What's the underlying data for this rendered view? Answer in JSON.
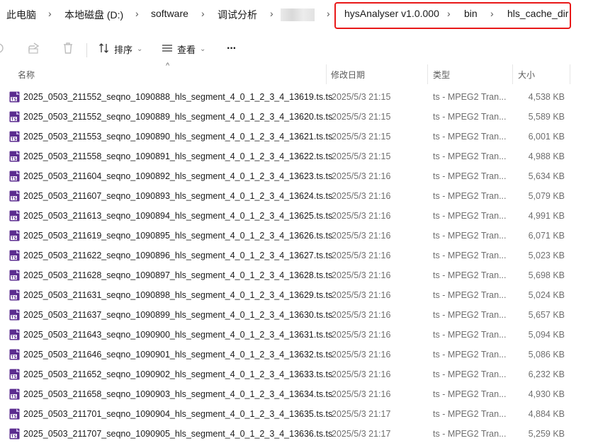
{
  "breadcrumb": {
    "items": [
      "此电脑",
      "本地磁盘 (D:)",
      "software",
      "调试分析",
      "hysAnalyser v1.0.000",
      "bin",
      "hls_cache_dir"
    ],
    "separator": "›"
  },
  "toolbar": {
    "sort_label": "排序",
    "view_label": "查看",
    "more_label": "···"
  },
  "columns": {
    "name": "名称",
    "date": "修改日期",
    "type": "类型",
    "size": "大小"
  },
  "files": [
    {
      "name": "2025_0503_211552_seqno_1090888_hls_segment_4_0_1_2_3_4_13619.ts.ts",
      "date": "2025/5/3 21:15",
      "type": "ts - MPEG2 Tran...",
      "size": "4,538 KB"
    },
    {
      "name": "2025_0503_211552_seqno_1090889_hls_segment_4_0_1_2_3_4_13620.ts.ts",
      "date": "2025/5/3 21:15",
      "type": "ts - MPEG2 Tran...",
      "size": "5,589 KB"
    },
    {
      "name": "2025_0503_211553_seqno_1090890_hls_segment_4_0_1_2_3_4_13621.ts.ts",
      "date": "2025/5/3 21:15",
      "type": "ts - MPEG2 Tran...",
      "size": "6,001 KB"
    },
    {
      "name": "2025_0503_211558_seqno_1090891_hls_segment_4_0_1_2_3_4_13622.ts.ts",
      "date": "2025/5/3 21:15",
      "type": "ts - MPEG2 Tran...",
      "size": "4,988 KB"
    },
    {
      "name": "2025_0503_211604_seqno_1090892_hls_segment_4_0_1_2_3_4_13623.ts.ts",
      "date": "2025/5/3 21:16",
      "type": "ts - MPEG2 Tran...",
      "size": "5,634 KB"
    },
    {
      "name": "2025_0503_211607_seqno_1090893_hls_segment_4_0_1_2_3_4_13624.ts.ts",
      "date": "2025/5/3 21:16",
      "type": "ts - MPEG2 Tran...",
      "size": "5,079 KB"
    },
    {
      "name": "2025_0503_211613_seqno_1090894_hls_segment_4_0_1_2_3_4_13625.ts.ts",
      "date": "2025/5/3 21:16",
      "type": "ts - MPEG2 Tran...",
      "size": "4,991 KB"
    },
    {
      "name": "2025_0503_211619_seqno_1090895_hls_segment_4_0_1_2_3_4_13626.ts.ts",
      "date": "2025/5/3 21:16",
      "type": "ts - MPEG2 Tran...",
      "size": "6,071 KB"
    },
    {
      "name": "2025_0503_211622_seqno_1090896_hls_segment_4_0_1_2_3_4_13627.ts.ts",
      "date": "2025/5/3 21:16",
      "type": "ts - MPEG2 Tran...",
      "size": "5,023 KB"
    },
    {
      "name": "2025_0503_211628_seqno_1090897_hls_segment_4_0_1_2_3_4_13628.ts.ts",
      "date": "2025/5/3 21:16",
      "type": "ts - MPEG2 Tran...",
      "size": "5,698 KB"
    },
    {
      "name": "2025_0503_211631_seqno_1090898_hls_segment_4_0_1_2_3_4_13629.ts.ts",
      "date": "2025/5/3 21:16",
      "type": "ts - MPEG2 Tran...",
      "size": "5,024 KB"
    },
    {
      "name": "2025_0503_211637_seqno_1090899_hls_segment_4_0_1_2_3_4_13630.ts.ts",
      "date": "2025/5/3 21:16",
      "type": "ts - MPEG2 Tran...",
      "size": "5,657 KB"
    },
    {
      "name": "2025_0503_211643_seqno_1090900_hls_segment_4_0_1_2_3_4_13631.ts.ts",
      "date": "2025/5/3 21:16",
      "type": "ts - MPEG2 Tran...",
      "size": "5,094 KB"
    },
    {
      "name": "2025_0503_211646_seqno_1090901_hls_segment_4_0_1_2_3_4_13632.ts.ts",
      "date": "2025/5/3 21:16",
      "type": "ts - MPEG2 Tran...",
      "size": "5,086 KB"
    },
    {
      "name": "2025_0503_211652_seqno_1090902_hls_segment_4_0_1_2_3_4_13633.ts.ts",
      "date": "2025/5/3 21:16",
      "type": "ts - MPEG2 Tran...",
      "size": "6,232 KB"
    },
    {
      "name": "2025_0503_211658_seqno_1090903_hls_segment_4_0_1_2_3_4_13634.ts.ts",
      "date": "2025/5/3 21:16",
      "type": "ts - MPEG2 Tran...",
      "size": "4,930 KB"
    },
    {
      "name": "2025_0503_211701_seqno_1090904_hls_segment_4_0_1_2_3_4_13635.ts.ts",
      "date": "2025/5/3 21:17",
      "type": "ts - MPEG2 Tran...",
      "size": "4,884 KB"
    },
    {
      "name": "2025_0503_211707_seqno_1090905_hls_segment_4_0_1_2_3_4_13636.ts.ts",
      "date": "2025/5/3 21:17",
      "type": "ts - MPEG2 Tran...",
      "size": "5,259 KB"
    }
  ],
  "colors": {
    "highlight_border": "#e81818",
    "ts_icon": "#5b2c8f"
  }
}
